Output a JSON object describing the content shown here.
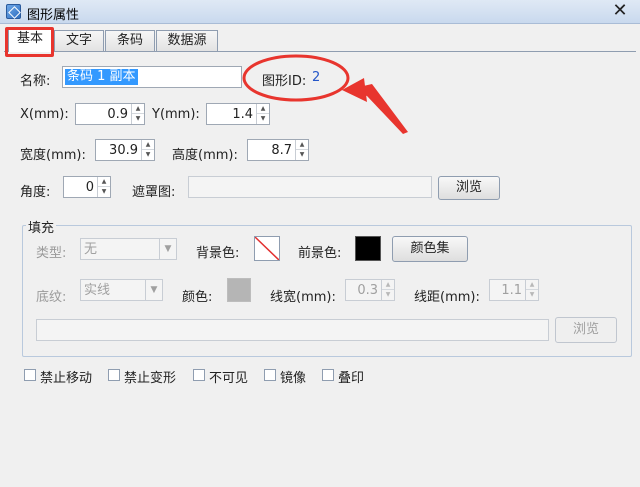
{
  "window": {
    "title": "图形属性",
    "close": "✕"
  },
  "tabs": [
    {
      "label": "基本"
    },
    {
      "label": "文字"
    },
    {
      "label": "条码"
    },
    {
      "label": "数据源"
    }
  ],
  "basic": {
    "name_label": "名称:",
    "name_value": "条码 1 副本",
    "id_label": "图形ID:",
    "id_value": "2",
    "x_label": "X(mm):",
    "x_value": "0.9",
    "y_label": "Y(mm):",
    "y_value": "1.4",
    "width_label": "宽度(mm):",
    "width_value": "30.9",
    "height_label": "高度(mm):",
    "height_value": "8.7",
    "angle_label": "角度:",
    "angle_value": "0",
    "mask_label": "遮罩图:",
    "mask_value": "",
    "browse_label": "浏览"
  },
  "fill": {
    "group_title": "填充",
    "type_label": "类型:",
    "type_value": "无",
    "bg_label": "背景色:",
    "fg_label": "前景色:",
    "fg_color": "#000000",
    "color_set_label": "颜色集",
    "pattern_label": "底纹:",
    "pattern_value": "实线",
    "color_label": "颜色:",
    "color_value": "#b5b5b5",
    "line_width_label": "线宽(mm):",
    "line_width_value": "0.3",
    "line_spacing_label": "线距(mm):",
    "line_spacing_value": "1.1",
    "image_path": "",
    "browse_label": "浏览"
  },
  "options": [
    {
      "label": "禁止移动",
      "checked": false
    },
    {
      "label": "禁止变形",
      "checked": false
    },
    {
      "label": "不可见",
      "checked": false
    },
    {
      "label": "镜像",
      "checked": false
    },
    {
      "label": "叠印",
      "checked": false
    }
  ],
  "annotation_color": "#e8352e"
}
